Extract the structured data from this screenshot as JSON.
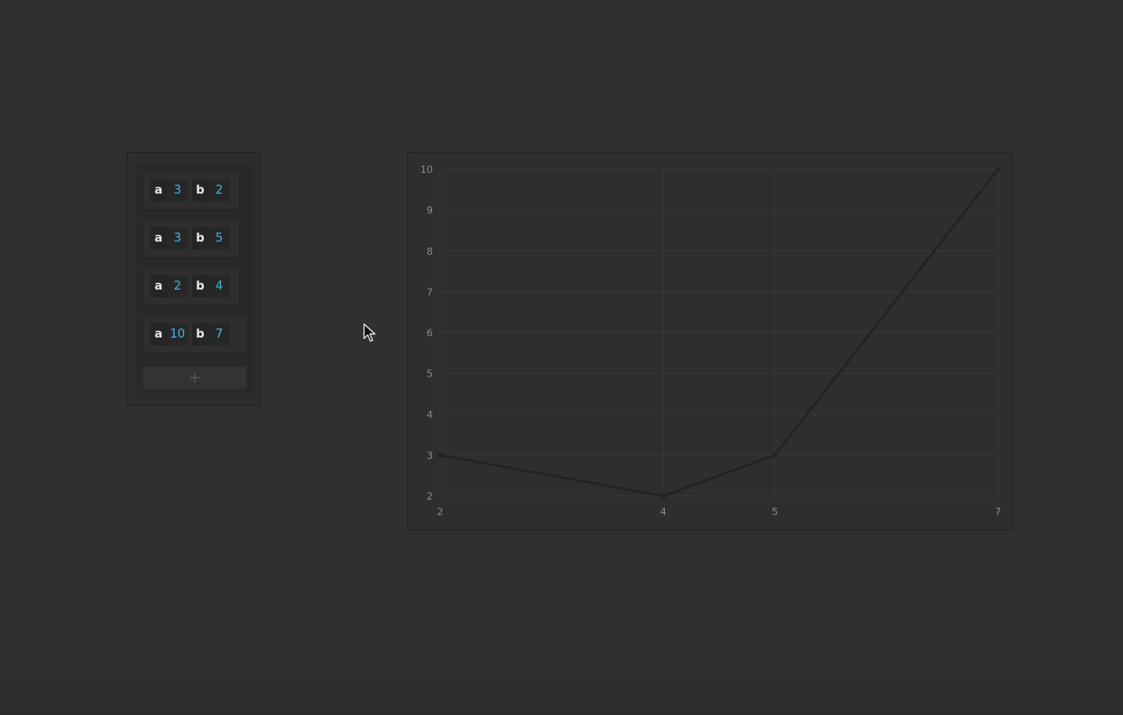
{
  "list": {
    "rows": [
      {
        "a_label": "a",
        "a_value": "3",
        "b_label": "b",
        "b_value": "2"
      },
      {
        "a_label": "a",
        "a_value": "3",
        "b_label": "b",
        "b_value": "5"
      },
      {
        "a_label": "a",
        "a_value": "2",
        "b_label": "b",
        "b_value": "4"
      },
      {
        "a_label": "a",
        "a_value": "10",
        "b_label": "b",
        "b_value": "7"
      }
    ],
    "add_label": "+"
  },
  "colors": {
    "value_accent": "#3fb8dd",
    "line": "#222222"
  },
  "chart_data": {
    "type": "line",
    "x": [
      2,
      4,
      5,
      7
    ],
    "series": [
      {
        "values": [
          3,
          2,
          3,
          10
        ]
      }
    ],
    "x_ticks": [
      "2",
      "4",
      "5",
      "7"
    ],
    "y_ticks": [
      "2",
      "3",
      "4",
      "5",
      "6",
      "7",
      "8",
      "9",
      "10"
    ],
    "xlim": [
      2,
      7
    ],
    "ylim": [
      2,
      10
    ],
    "grid": true,
    "title": "",
    "xlabel": "",
    "ylabel": ""
  }
}
